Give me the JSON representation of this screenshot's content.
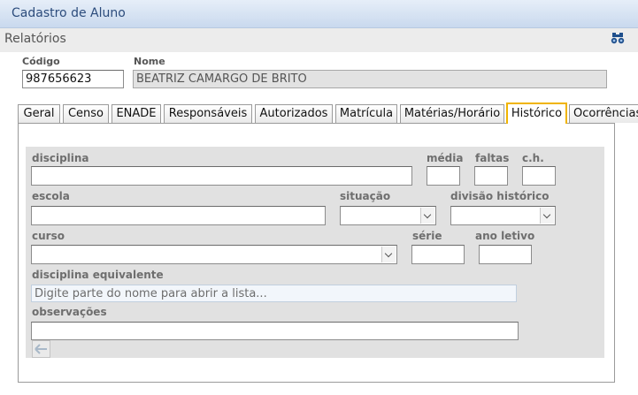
{
  "window": {
    "title": "Cadastro de Aluno"
  },
  "toolbar": {
    "reports_label": "Relatórios",
    "search_icon": "binoculars-icon"
  },
  "header": {
    "codigo_label": "Código",
    "codigo_value": "987656623",
    "nome_label": "Nome",
    "nome_value": "BEATRIZ CAMARGO DE BRITO"
  },
  "tabs": [
    {
      "label": "Geral"
    },
    {
      "label": "Censo"
    },
    {
      "label": "ENADE"
    },
    {
      "label": "Responsáveis"
    },
    {
      "label": "Autorizados"
    },
    {
      "label": "Matrícula"
    },
    {
      "label": "Matérias/Horário"
    },
    {
      "label": "Histórico",
      "active": true
    },
    {
      "label": "Ocorrências"
    }
  ],
  "form": {
    "disciplina_label": "disciplina",
    "media_label": "média",
    "faltas_label": "faltas",
    "ch_label": "c.h.",
    "escola_label": "escola",
    "situacao_label": "situação",
    "divisao_label": "divisão histórico",
    "curso_label": "curso",
    "serie_label": "série",
    "ano_label": "ano letivo",
    "equivalente_label": "disciplina equivalente",
    "equivalente_placeholder": "Digite parte do nome para abrir a lista...",
    "observacoes_label": "observações",
    "back_icon": "back-arrow-icon"
  },
  "colors": {
    "active_tab_border": "#f0b400",
    "title_text": "#2c4c7c"
  }
}
